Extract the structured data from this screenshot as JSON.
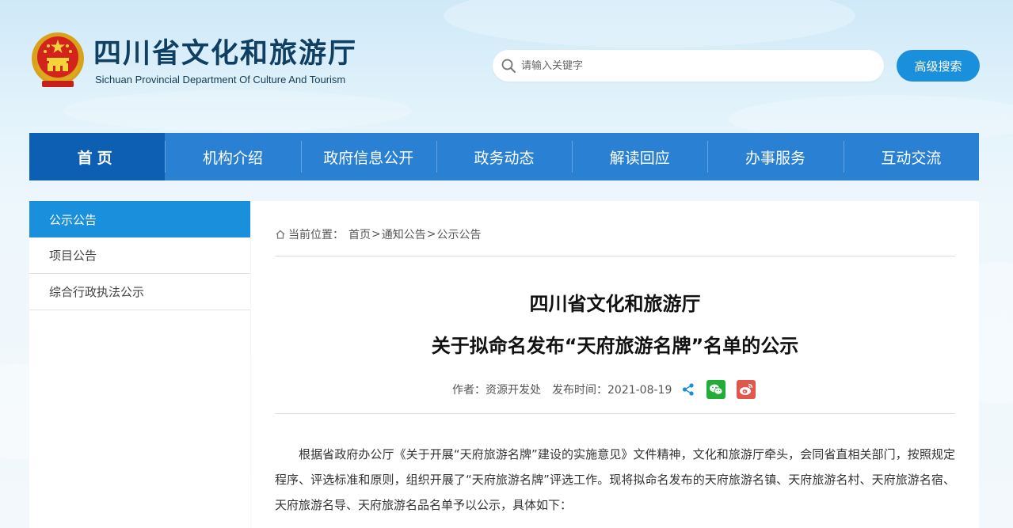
{
  "header": {
    "title": "四川省文化和旅游厅",
    "subtitle": "Sichuan Provincial Department Of Culture And Tourism",
    "search_placeholder": "请输入关键字",
    "advanced_search_label": "高级搜索"
  },
  "nav": {
    "items": [
      "首页",
      "机构介绍",
      "政府信息公开",
      "政务动态",
      "解读回应",
      "办事服务",
      "互动交流"
    ],
    "active_index": 0
  },
  "sidebar": {
    "items": [
      "公示公告",
      "项目公告",
      "综合行政执法公示"
    ],
    "active_index": 0
  },
  "breadcrumb": {
    "prefix": "当前位置：",
    "items": [
      "首页",
      "通知公告",
      "公示公告"
    ],
    "separator": ">"
  },
  "article": {
    "title_line1": "四川省文化和旅游厅",
    "title_line2": "关于拟命名发布“天府旅游名牌”名单的公示",
    "author": "作者：资源开发处",
    "publish_time": "发布时间：2021-08-19",
    "body": "根据省政府办公厅《关于开展“天府旅游名牌”建设的实施意见》文件精神，文化和旅游厅牵头，会同省直相关部门，按照规定程序、评选标准和原则，组织开展了“天府旅游名牌”评选工作。现将拟命名发布的天府旅游名镇、天府旅游名村、天府旅游名宿、天府旅游名导、天府旅游名品名单予以公示，具体如下："
  },
  "icons": {
    "search": "search-icon",
    "home": "home-icon",
    "share": "share-icon",
    "wechat": "wechat-icon",
    "weibo": "weibo-icon",
    "emblem": "national-emblem-icon"
  },
  "colors": {
    "nav_bg": "#2a80d2",
    "nav_active": "#0c5fb3",
    "accent": "#1a8fdc",
    "title_color": "#0f3f63",
    "wechat_green": "#22ac38",
    "weibo_red": "#e2574c"
  }
}
